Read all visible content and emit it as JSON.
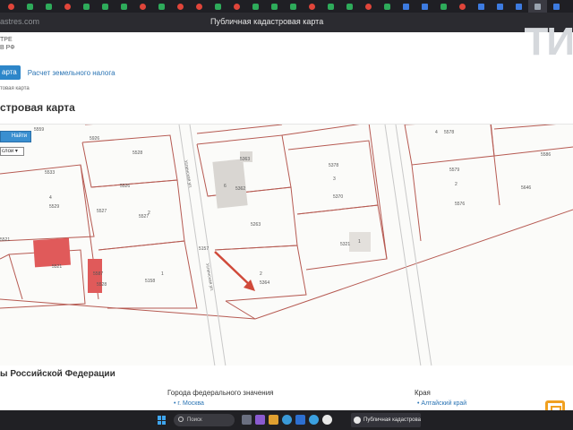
{
  "browser": {
    "url_fragment": "astres.com",
    "page_title": "Публичная кадастровая карта"
  },
  "site": {
    "head_line1": "ТРЕ",
    "head_line2": "В РФ"
  },
  "nav": {
    "active": "арта",
    "link": "Расчет земельного налога"
  },
  "breadcrumb": "товая карта",
  "page_title": "стровая карта",
  "map": {
    "find_button": "Найти",
    "layer_select": "слои",
    "parcel_labels": [
      {
        "t": "5559"
      },
      {
        "t": "5926"
      },
      {
        "t": "5528"
      },
      {
        "t": "5533"
      },
      {
        "t": "4"
      },
      {
        "t": "5529"
      },
      {
        "t": "5526"
      },
      {
        "t": "5527"
      },
      {
        "t": "2"
      },
      {
        "t": "5527"
      },
      {
        "t": "5528"
      },
      {
        "t": "5158"
      },
      {
        "t": "1"
      },
      {
        "t": "5363"
      },
      {
        "t": "6"
      },
      {
        "t": "5362"
      },
      {
        "t": "5263"
      },
      {
        "t": "2"
      },
      {
        "t": "5364"
      },
      {
        "t": "5378"
      },
      {
        "t": "3"
      },
      {
        "t": "5370"
      },
      {
        "t": "5321"
      },
      {
        "t": "1"
      },
      {
        "t": "4"
      },
      {
        "t": "5578"
      },
      {
        "t": "5579"
      },
      {
        "t": "2"
      },
      {
        "t": "5576"
      },
      {
        "t": "5586"
      },
      {
        "t": "5646"
      },
      {
        "t": "5157"
      },
      {
        "t": "5521"
      },
      {
        "t": "5587"
      },
      {
        "t": "5521"
      }
    ],
    "street_labels": [
      "Успенская ул.",
      "Успенская ул."
    ]
  },
  "footer": {
    "section_title": "ы Российской Федерации",
    "col_federal_title": "Города федерального значения",
    "col_federal_link": "г. Москва",
    "col_krai_title": "Края",
    "col_krai_link": "Алтайский край"
  },
  "taskbar": {
    "search_label": "Поиск",
    "app_label": "Публичная кадастрова"
  },
  "colors": {
    "accent": "#2d86c9",
    "parcel_line": "#b65a52",
    "building": "#e05a5a",
    "taskbar": "#202024"
  },
  "icons": {
    "browser_tabs": "favicon-icons",
    "windows": "windows-icon",
    "search": "search-icon",
    "app": "browser-icon"
  }
}
